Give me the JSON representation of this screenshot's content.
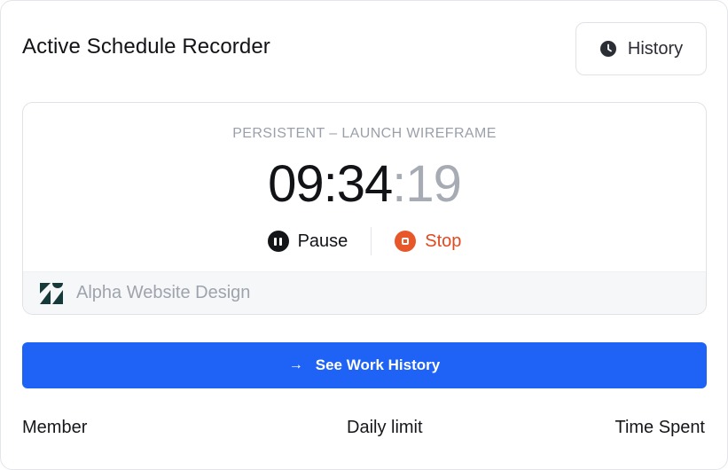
{
  "header": {
    "title": "Active Schedule Recorder",
    "history_label": "History"
  },
  "timer": {
    "session_label": "PERSISTENT – LAUNCH WIREFRAME",
    "hours_minutes": "09:34",
    "seconds": ":19",
    "pause_label": "Pause",
    "stop_label": "Stop",
    "project_name": "Alpha Website Design",
    "project_icon": "zendesk-logo-icon"
  },
  "cta": {
    "arrow": "→",
    "label": "See Work History"
  },
  "table": {
    "columns": [
      "Member",
      "Daily limit",
      "Time Spent"
    ]
  },
  "colors": {
    "primary": "#1e63f5",
    "stop": "#e8572a",
    "muted": "#a7abb4"
  }
}
